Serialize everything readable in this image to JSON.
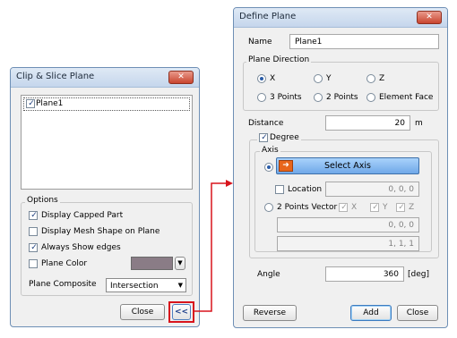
{
  "clip_dialog": {
    "title": "Clip & Slice Plane",
    "close_glyph": "✕",
    "plane_list": [
      {
        "label": "Plane1",
        "checked": true
      }
    ],
    "options_title": "Options",
    "opt_capped": "Display Capped Part",
    "opt_mesh": "Display Mesh Shape on Plane",
    "opt_edges": "Always Show edges",
    "opt_color": "Plane Color",
    "plane_color_swatch": "#8a7c86",
    "plane_composite_label": "Plane Composite",
    "plane_composite_value": "Intersection",
    "close_button": "Close",
    "toggle_button": "<<"
  },
  "define_dialog": {
    "title": "Define Plane",
    "close_glyph": "✕",
    "name_label": "Name",
    "name_value": "Plane1",
    "direction_title": "Plane Direction",
    "dir_x": "X",
    "dir_y": "Y",
    "dir_z": "Z",
    "dir_3pts": "3 Points",
    "dir_2pts": "2 Points",
    "dir_face": "Element Face",
    "distance_label": "Distance",
    "distance_value": "20",
    "distance_unit": "m",
    "degree_label": "Degree",
    "axis_title": "Axis",
    "select_axis_button": "Select Axis",
    "location_label": "Location",
    "location_value": "0, 0, 0",
    "vector_label": "2 Points Vector",
    "vec_x": "X",
    "vec_y": "Y",
    "vec_z": "Z",
    "vector_p1": "0, 0, 0",
    "vector_p2": "1, 1, 1",
    "angle_label": "Angle",
    "angle_value": "360",
    "angle_unit": "[deg]",
    "reverse_button": "Reverse",
    "add_button": "Add",
    "close_button": "Close"
  },
  "colors": {
    "highlight_red": "#d8141c",
    "select_axis_blue": "#6fa8e8",
    "arrow_icon": "#e8651b"
  }
}
